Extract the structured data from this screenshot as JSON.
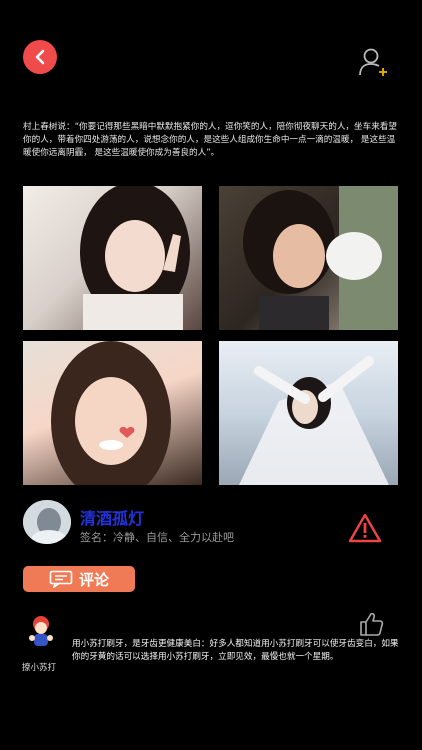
{
  "header": {
    "back_icon": "chevron-left-icon",
    "add_user_icon": "add-user-icon"
  },
  "quote": "村上春树说：“你要记得那些黑暗中默默抱紧你的人，逗你笑的人，陪你彻夜聊天的人，坐车来看望你的人，带着你四处游荡的人，说想念你的人，是这些人组成你生命中一点一滴的温暖， 是这些温暖使你远离阴霾， 是这些温暖使你成为善良的人”。",
  "profile": {
    "name": "清酒孤灯",
    "signature": "签名：冷静、自信、全力以赴吧",
    "warning_icon": "warning-icon"
  },
  "comment_button": {
    "label": "评论",
    "icon": "comment-icon"
  },
  "comment": {
    "author": "撩小苏打",
    "text": "用小苏打刷牙，是牙齿更健康美白：好多人都知道用小苏打刷牙可以使牙齿变白，如果你的牙黄的话可以选择用小苏打刷牙，立即见效，最慢也就一个星期。",
    "like_icon": "thumbs-up-icon"
  },
  "colors": {
    "accent_red": "#f04b4b",
    "comment_orange": "#f07a55",
    "name_blue": "#2233dd",
    "background": "#000000"
  }
}
